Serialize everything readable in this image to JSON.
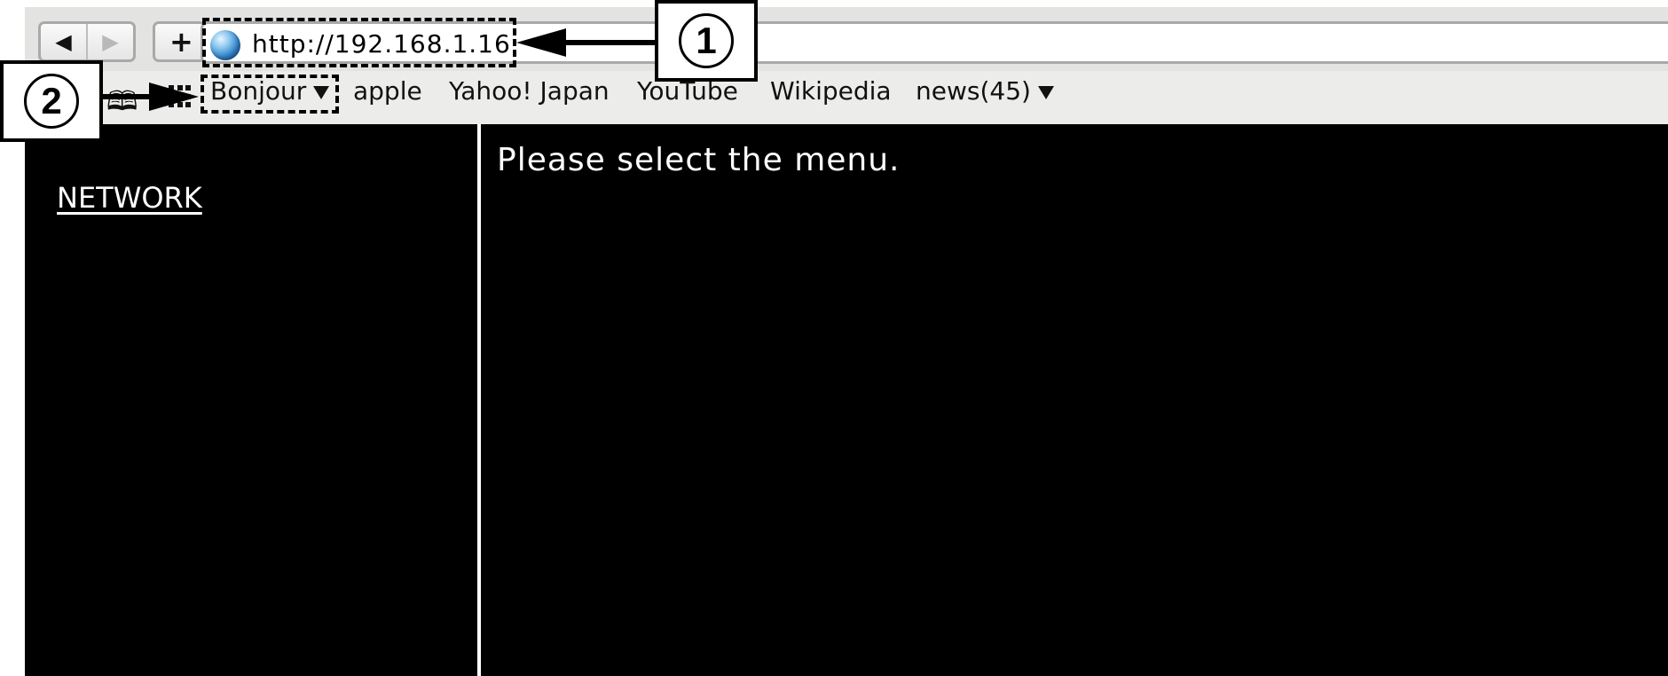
{
  "browser": {
    "back_label": "◀",
    "forward_label": "▶",
    "add_label": "+",
    "url": "http://192.168.1.16"
  },
  "bookmarks": {
    "items": [
      {
        "label": "Bonjour"
      },
      {
        "label": "apple"
      },
      {
        "label": "Yahoo! Japan"
      },
      {
        "label": "YouTube"
      },
      {
        "label": "Wikipedia"
      },
      {
        "label": "news(45)"
      }
    ]
  },
  "sidebar": {
    "network_label": "NETWORK"
  },
  "main": {
    "message": "Please select the menu."
  },
  "callouts": {
    "one": "1",
    "two": "2"
  },
  "colors": {
    "page_background": "#000000",
    "chrome": "#e8e8e6",
    "text_on_dark": "#ffffff"
  },
  "icons": {
    "site": "globe-icon",
    "bookmarks": "book-icon",
    "top_sites": "grid-icon"
  }
}
